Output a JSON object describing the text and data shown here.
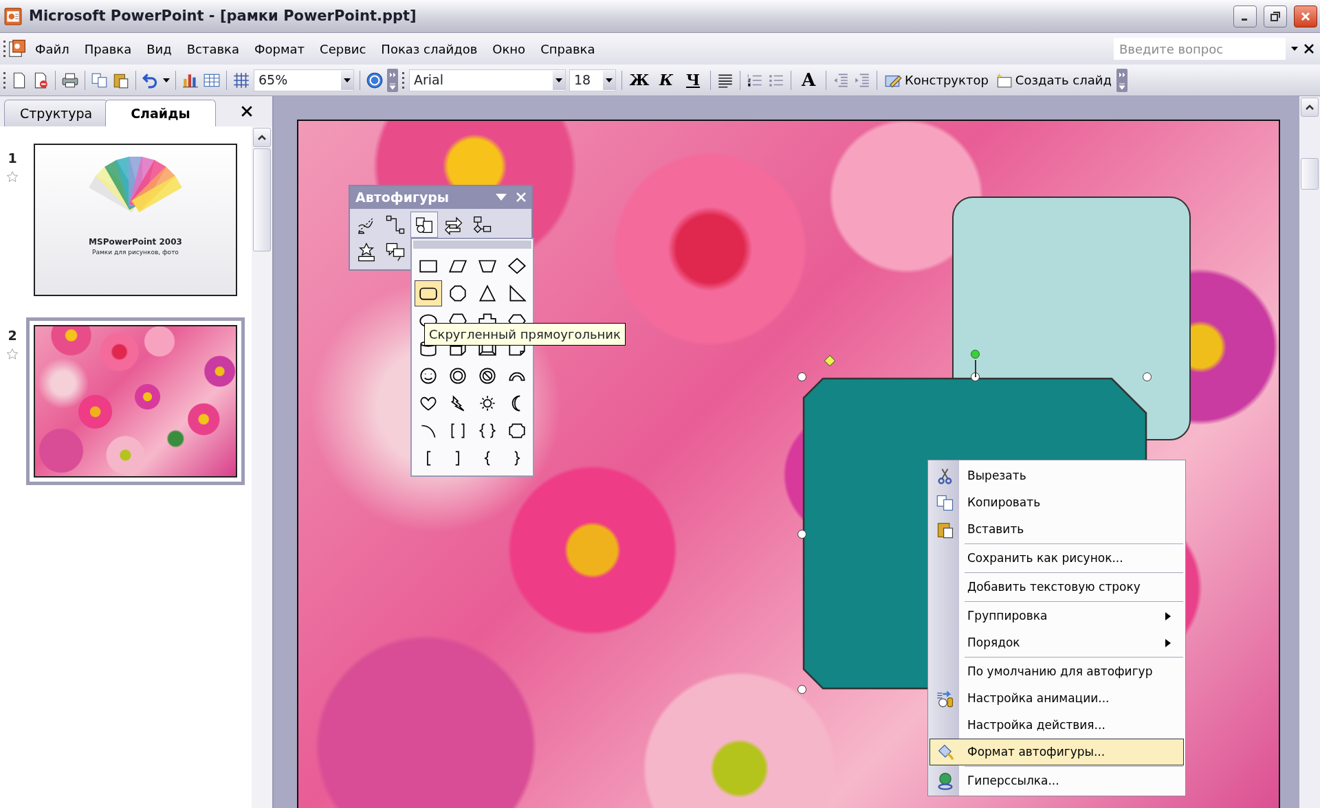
{
  "window": {
    "title": "Microsoft PowerPoint - [рамки PowerPoint.ppt]"
  },
  "menu_bar": {
    "items": [
      "Файл",
      "Правка",
      "Вид",
      "Вставка",
      "Формат",
      "Сервис",
      "Показ слайдов",
      "Окно",
      "Справка"
    ],
    "help_box": {
      "placeholder": "Введите вопрос"
    }
  },
  "toolbar": {
    "zoom": "65%",
    "font": "Arial",
    "font_size": "18",
    "format_buttons": [
      {
        "label": "Ж",
        "kind": "bold"
      },
      {
        "label": "К",
        "kind": "italic"
      },
      {
        "label": "Ч",
        "kind": "underline"
      }
    ],
    "grow_font": "A",
    "buttons": [
      "Конструктор",
      "Создать слайд"
    ]
  },
  "side_pane": {
    "tabs": [
      {
        "label": "Структура",
        "selected": false
      },
      {
        "label": "Слайды",
        "selected": true
      }
    ],
    "slides": [
      {
        "number": "1",
        "kind": "title",
        "selected": false,
        "title": "MSPowerPoint 2003",
        "subtitle": "Рамки для рисунков, фото"
      },
      {
        "number": "2",
        "kind": "photo",
        "selected": true
      }
    ]
  },
  "autoshapes_toolbar": {
    "title": "Автофигуры",
    "categories": [
      {
        "selected": false
      },
      {
        "selected": false
      },
      {
        "selected": true
      },
      {
        "selected": false
      },
      {
        "selected": false
      },
      {
        "selected": false
      },
      {
        "selected": false
      }
    ],
    "shapes": [
      {
        "kind": "rectangle",
        "selected": false
      },
      {
        "kind": "parallelogram",
        "selected": false
      },
      {
        "kind": "trapezoid",
        "selected": false
      },
      {
        "kind": "diamond",
        "selected": false
      },
      {
        "kind": "rounded-rectangle",
        "selected": true
      },
      {
        "kind": "octagon",
        "selected": false
      },
      {
        "kind": "triangle",
        "selected": false
      },
      {
        "kind": "right-triangle",
        "selected": false
      },
      {
        "kind": "ellipse",
        "selected": false
      },
      {
        "kind": "hexagon",
        "selected": false
      },
      {
        "kind": "cross",
        "selected": false
      },
      {
        "kind": "plaque",
        "selected": false
      },
      {
        "kind": "can",
        "selected": false
      },
      {
        "kind": "cube",
        "selected": false
      },
      {
        "kind": "bevel",
        "selected": false
      },
      {
        "kind": "folded-corner",
        "selected": false
      },
      {
        "kind": "smiley",
        "selected": false
      },
      {
        "kind": "donut",
        "selected": false
      },
      {
        "kind": "no-symbol",
        "selected": false
      },
      {
        "kind": "block-arc",
        "selected": false
      },
      {
        "kind": "heart",
        "selected": false
      },
      {
        "kind": "lightning",
        "selected": false
      },
      {
        "kind": "sun",
        "selected": false
      },
      {
        "kind": "moon",
        "selected": false
      },
      {
        "kind": "arc",
        "selected": false
      },
      {
        "kind": "double-bracket",
        "selected": false
      },
      {
        "kind": "double-brace",
        "selected": false
      },
      {
        "kind": "plaque-frame",
        "selected": false
      },
      {
        "kind": "left-bracket",
        "selected": false
      },
      {
        "kind": "right-bracket",
        "selected": false
      },
      {
        "kind": "left-brace",
        "selected": false
      },
      {
        "kind": "right-brace",
        "selected": false
      }
    ],
    "tooltip": "Скругленный прямоугольник"
  },
  "context_menu": {
    "items": [
      {
        "label": "Вырезать",
        "divider_above": false,
        "submenu": false,
        "selected": false
      },
      {
        "label": "Копировать",
        "divider_above": false,
        "submenu": false,
        "selected": false
      },
      {
        "label": "Вставить",
        "divider_above": false,
        "submenu": false,
        "selected": false
      },
      {
        "label": "Сохранить как рисунок...",
        "divider_above": true,
        "submenu": false,
        "selected": false
      },
      {
        "label": "Добавить текстовую строку",
        "divider_above": true,
        "submenu": false,
        "selected": false
      },
      {
        "label": "Группировка",
        "divider_above": true,
        "submenu": true,
        "selected": false
      },
      {
        "label": "Порядок",
        "divider_above": false,
        "submenu": true,
        "selected": false
      },
      {
        "label": "По умолчанию для автофигур",
        "divider_above": true,
        "submenu": false,
        "selected": false
      },
      {
        "label": "Настройка анимации...",
        "divider_above": false,
        "submenu": false,
        "selected": false
      },
      {
        "label": "Настройка действия...",
        "divider_above": false,
        "submenu": false,
        "selected": false
      },
      {
        "label": "Формат автофигуры...",
        "divider_above": false,
        "submenu": false,
        "selected": true
      },
      {
        "label": "Гиперссылка...",
        "divider_above": true,
        "submenu": false,
        "selected": false
      }
    ]
  }
}
